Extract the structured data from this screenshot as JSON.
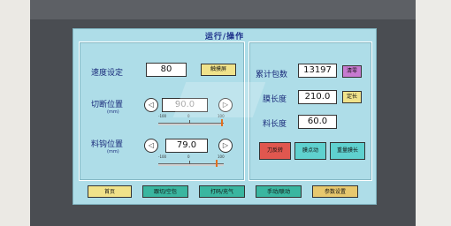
{
  "title": "运行/操作",
  "left": {
    "speed_label": "速度设定",
    "speed_value": "80",
    "touch_screen_btn": "触摸屏",
    "cut_label": "切断位置",
    "cut_unit": "(mm)",
    "cut_value": "90.0",
    "cut_scale_min": "-100",
    "cut_scale_mid": "0",
    "cut_scale_max": "100",
    "hook_label": "料钩位置",
    "hook_unit": "(mm)",
    "hook_value": "79.0",
    "hook_scale_min": "-100",
    "hook_scale_mid": "0",
    "hook_scale_max": "100"
  },
  "right": {
    "count_label": "累计包数",
    "count_value": "13197",
    "clear_btn": "清零",
    "film_len_label": "膜长度",
    "film_len_value": "210.0",
    "fixed_len_btn": "定长",
    "material_len_label": "料长度",
    "material_len_value": "60.0",
    "knife_reverse_btn": "刀反转",
    "film_jog_btn": "膜点动",
    "remeasure_btn": "重量膜长"
  },
  "bottom": {
    "home": "首页",
    "cut_bag": "跟切/空包",
    "print_inflate": "打码/充气",
    "manual_auto": "手动/联动",
    "params": "参数设置"
  },
  "colors": {
    "screen_bg": "#aedde8",
    "yellow_btn": "#f0e28a",
    "pink_btn": "#c77ad0",
    "cyan_btn": "#5fd1cf",
    "red_btn": "#e0574f"
  }
}
